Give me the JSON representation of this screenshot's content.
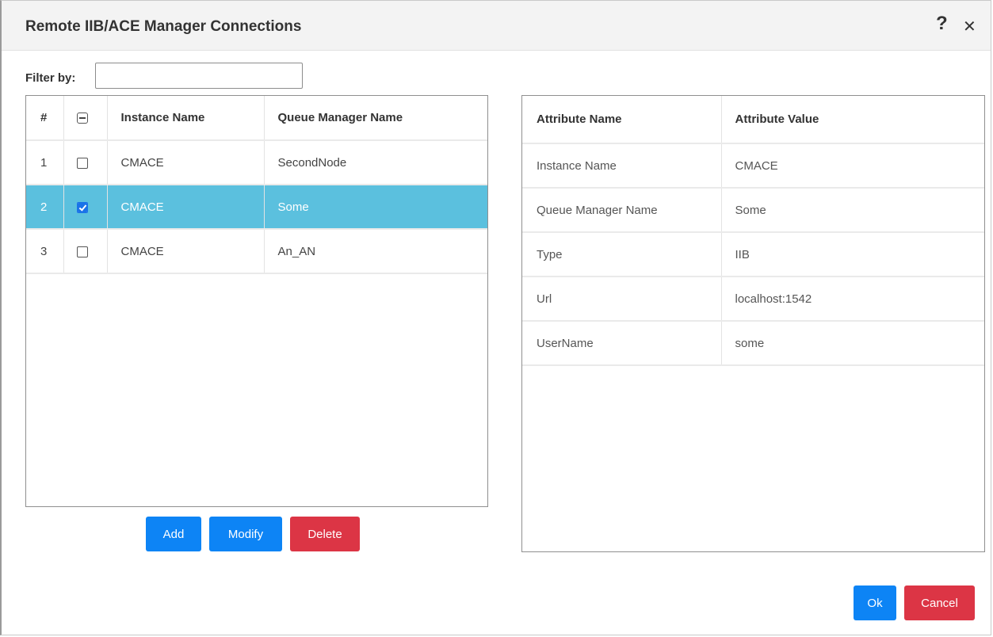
{
  "dialog": {
    "title": "Remote IIB/ACE Manager Connections",
    "help_symbol": "?",
    "close_symbol": "✕"
  },
  "filter": {
    "label": "Filter by:",
    "value": "",
    "placeholder": ""
  },
  "connections_table": {
    "headers": {
      "num": "#",
      "instance": "Instance Name",
      "queue_manager": "Queue Manager Name"
    },
    "rows": [
      {
        "num": "1",
        "checked": false,
        "instance": "CMACE",
        "queue_manager": "SecondNode"
      },
      {
        "num": "2",
        "checked": true,
        "instance": "CMACE",
        "queue_manager": "Some"
      },
      {
        "num": "3",
        "checked": false,
        "instance": "CMACE",
        "queue_manager": "An_AN"
      }
    ]
  },
  "actions": {
    "add": "Add",
    "modify": "Modify",
    "delete": "Delete"
  },
  "attributes_table": {
    "headers": {
      "name": "Attribute Name",
      "value": "Attribute Value"
    },
    "rows": [
      {
        "name": "Instance Name",
        "value": "CMACE"
      },
      {
        "name": "Queue Manager Name",
        "value": "Some"
      },
      {
        "name": "Type",
        "value": "IIB"
      },
      {
        "name": "Url",
        "value": "localhost:1542"
      },
      {
        "name": "UserName",
        "value": "some"
      }
    ]
  },
  "footer": {
    "ok": "Ok",
    "cancel": "Cancel"
  },
  "colors": {
    "selected_row": "#5bc0de",
    "primary": "#0d84f5",
    "danger": "#dc3545"
  }
}
